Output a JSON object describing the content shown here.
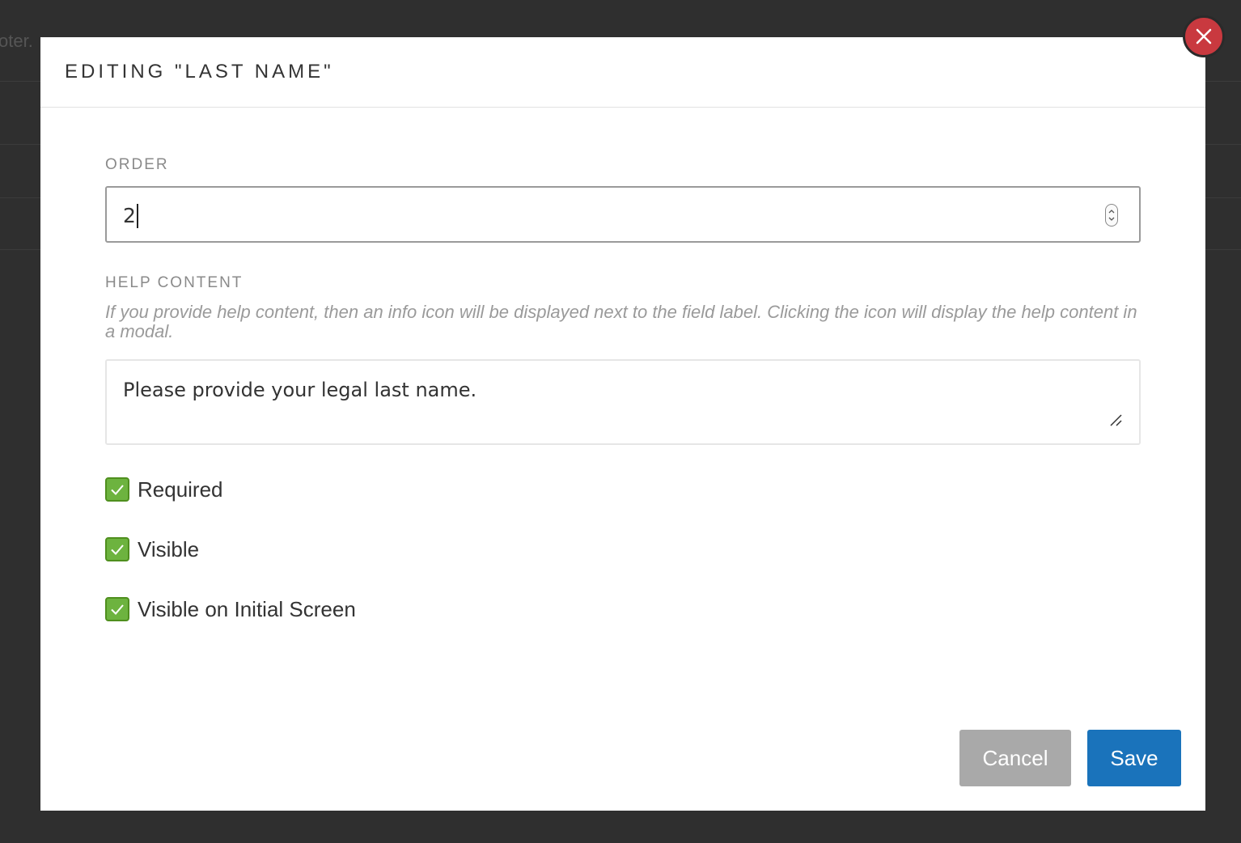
{
  "background": {
    "partial_text": "oter."
  },
  "modal": {
    "title": "EDITING \"LAST NAME\""
  },
  "order": {
    "label": "ORDER",
    "value": "2"
  },
  "help": {
    "label": "HELP CONTENT",
    "description": "If you provide help content, then an info icon will be displayed next to the field label. Clicking the icon will display the help content in a modal.",
    "value": "Please provide your legal last name."
  },
  "checkboxes": [
    {
      "label": "Required",
      "checked": true
    },
    {
      "label": "Visible",
      "checked": true
    },
    {
      "label": "Visible on Initial Screen",
      "checked": true
    }
  ],
  "buttons": {
    "cancel_label": "Cancel",
    "save_label": "Save"
  },
  "icons": {
    "close": "close-icon",
    "checkmark": "checkmark-icon",
    "spinner": "number-spinner-icon",
    "resize": "resize-handle-icon"
  },
  "colors": {
    "close_button": "#c9393f",
    "checkbox": "#6db33f",
    "save_button": "#1a73bb",
    "cancel_button": "#a9a9a9"
  }
}
